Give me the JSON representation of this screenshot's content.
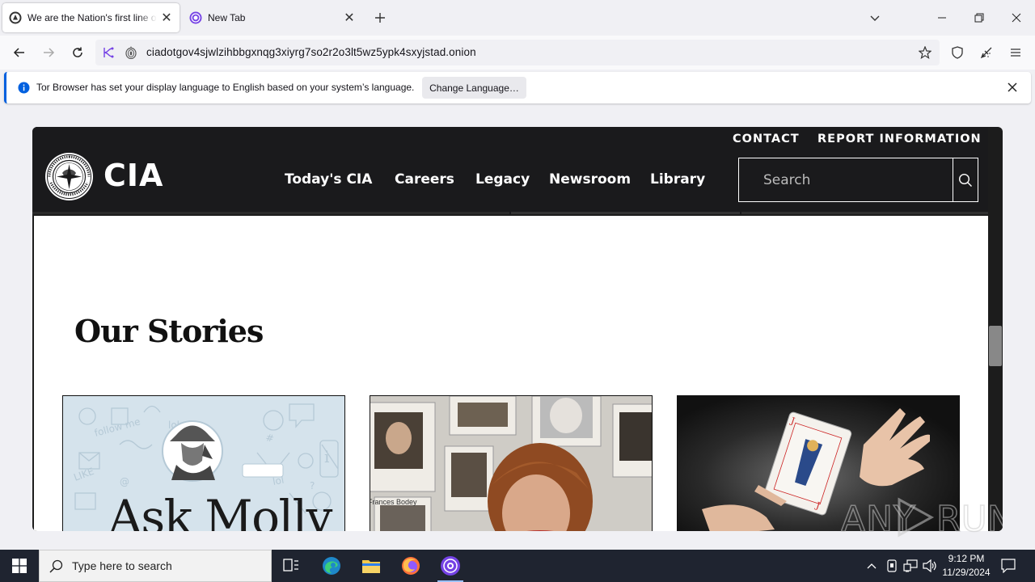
{
  "browser": {
    "tabs": [
      {
        "title": "We are the Nation's first line of",
        "active": true
      },
      {
        "title": "New Tab",
        "active": false
      }
    ],
    "url": "ciadotgov4sjwlzihbbgxnqg3xiyrg7so2r2o3lt5wz5ypk4sxyjstad.onion",
    "notification": {
      "text": "Tor Browser has set your display language to English based on your system’s language.",
      "button_label": "Change Language…"
    }
  },
  "site": {
    "wordmark": "CIA",
    "utility_nav": [
      "CONTACT",
      "REPORT INFORMATION"
    ],
    "main_nav": [
      "Today's CIA",
      "Careers",
      "Legacy",
      "Newsroom",
      "Library"
    ],
    "search": {
      "placeholder": "Search"
    },
    "section_title": "Our Stories",
    "cards": [
      {
        "title_fragment": "Ask Molly"
      },
      {
        "caption_fragment": "Frances Bodey"
      },
      {
        "caption_fragment": ""
      }
    ]
  },
  "watermark": {
    "text": "ANY RUN"
  },
  "taskbar": {
    "search_placeholder": "Type here to search",
    "time": "9:12 PM",
    "date": "11/29/2024"
  },
  "colors": {
    "site_header": "#1a1a1c",
    "taskbar": "#1f2430",
    "tor_purple": "#7542e5",
    "notification_accent": "#0060df"
  }
}
